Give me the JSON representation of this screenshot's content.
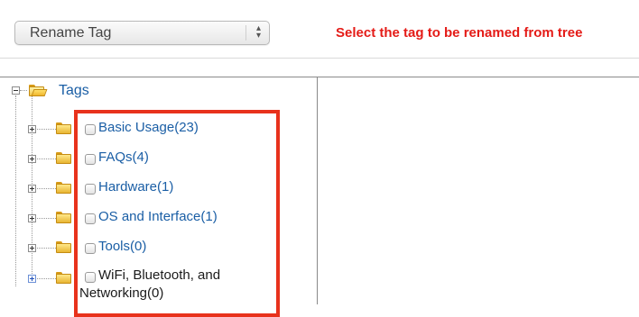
{
  "action_select": {
    "value": "Rename Tag"
  },
  "hint": "Select the tag to be renamed from tree",
  "tree": {
    "root": "Tags",
    "items": [
      {
        "label": "Basic Usage(23)"
      },
      {
        "label": "FAQs(4)"
      },
      {
        "label": "Hardware(1)"
      },
      {
        "label": "OS and Interface(1)"
      },
      {
        "label": "Tools(0)"
      },
      {
        "label": "WiFi, Bluetooth, and",
        "label2": "Networking(0)"
      }
    ]
  },
  "colors": {
    "hint": "#e41b17",
    "link": "#1a5ea5",
    "highlight": "#e8321c"
  }
}
